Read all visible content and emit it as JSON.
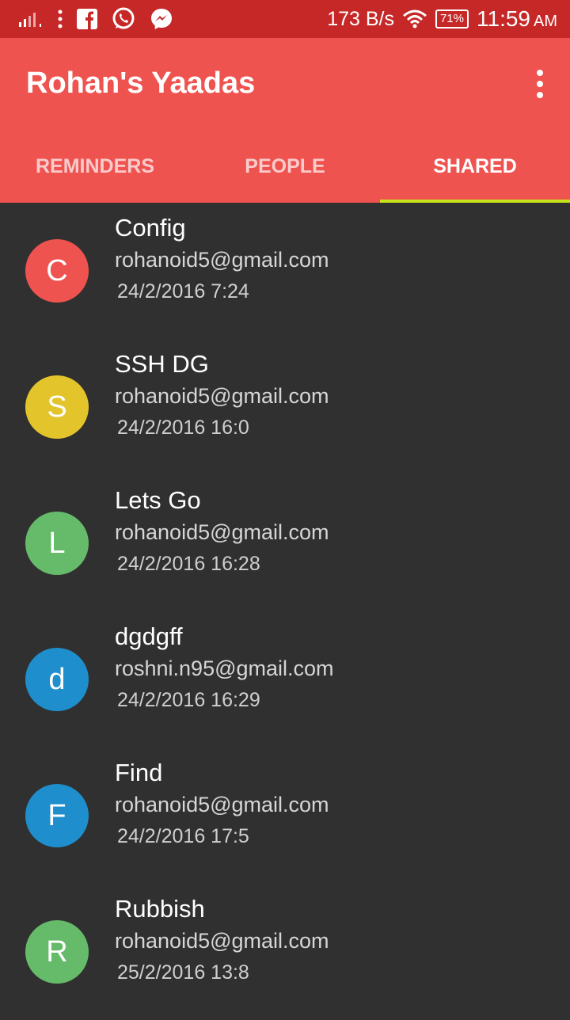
{
  "status_bar": {
    "net_speed": "173 B/s",
    "battery": "71%",
    "time": "11:59",
    "ampm": "AM"
  },
  "app_bar": {
    "title": "Rohan's Yaadas"
  },
  "tabs": [
    {
      "label": "REMINDERS",
      "active": false
    },
    {
      "label": "PEOPLE",
      "active": false
    },
    {
      "label": "SHARED",
      "active": true
    }
  ],
  "items": [
    {
      "initial": "C",
      "color": "#EF5350",
      "title": "Config",
      "email": "rohanoid5@gmail.com",
      "date": "24/2/2016 7:24"
    },
    {
      "initial": "S",
      "color": "#E3C42A",
      "title": "SSH DG",
      "email": "rohanoid5@gmail.com",
      "date": "24/2/2016 16:0"
    },
    {
      "initial": "L",
      "color": "#66BB6A",
      "title": "Lets Go",
      "email": "rohanoid5@gmail.com",
      "date": "24/2/2016 16:28"
    },
    {
      "initial": "d",
      "color": "#1E8FCC",
      "title": "dgdgff",
      "email": "roshni.n95@gmail.com",
      "date": "24/2/2016 16:29"
    },
    {
      "initial": "F",
      "color": "#1E8FCC",
      "title": "Find",
      "email": "rohanoid5@gmail.com",
      "date": "24/2/2016 17:5"
    },
    {
      "initial": "R",
      "color": "#66BB6A",
      "title": "Rubbish",
      "email": "rohanoid5@gmail.com",
      "date": "25/2/2016 13:8"
    }
  ]
}
